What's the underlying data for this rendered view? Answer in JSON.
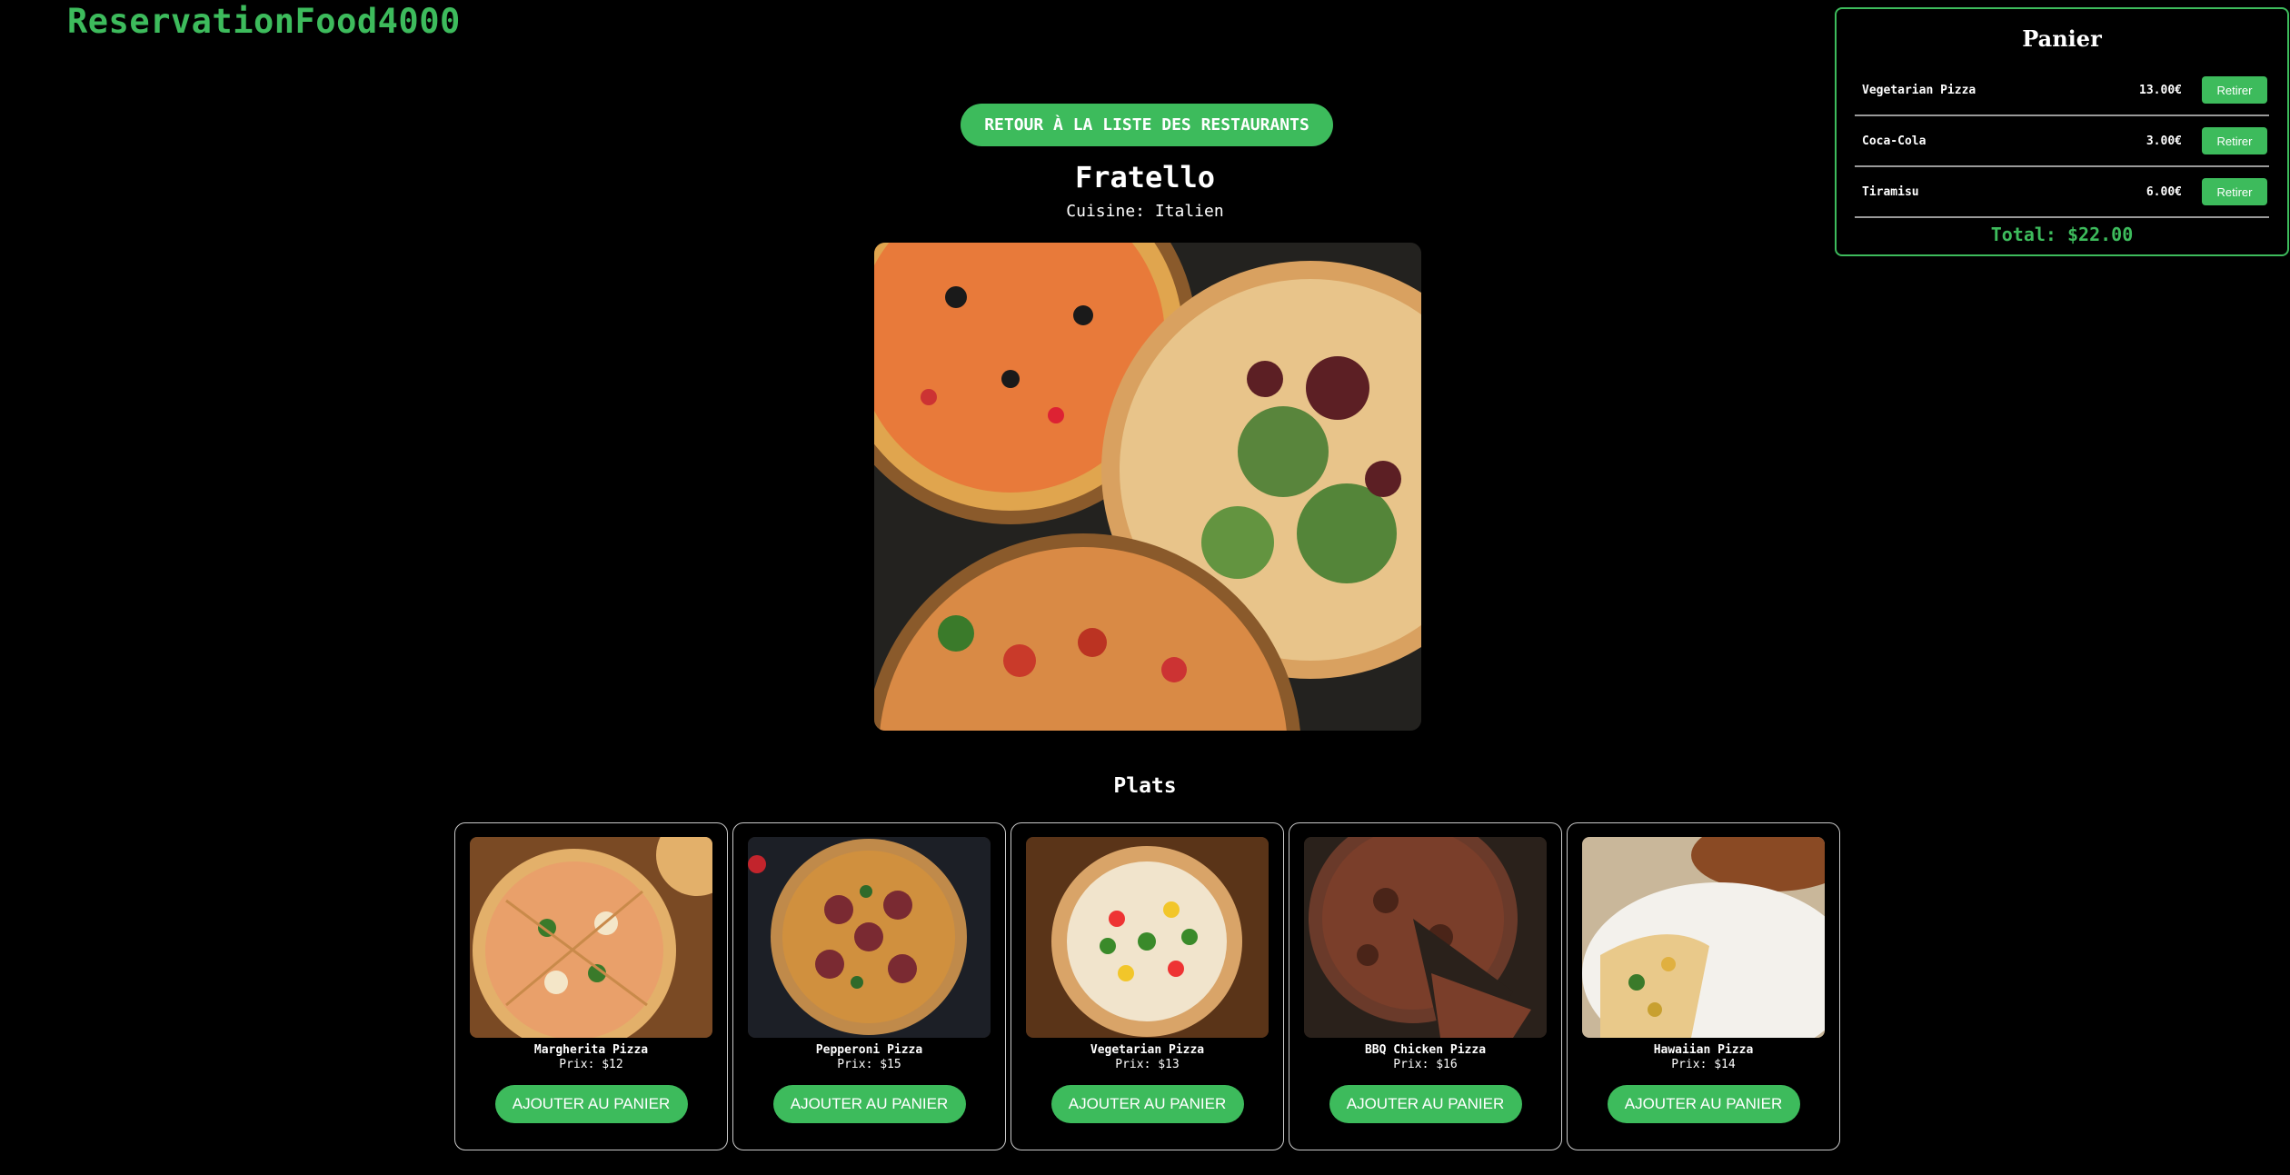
{
  "app": {
    "brand": "ReservationFood4000"
  },
  "cart": {
    "title": "Panier",
    "items": [
      {
        "name": "Vegetarian Pizza",
        "price": "13.00€",
        "remove_label": "Retirer"
      },
      {
        "name": "Coca-Cola",
        "price": "3.00€",
        "remove_label": "Retirer"
      },
      {
        "name": "Tiramisu",
        "price": "6.00€",
        "remove_label": "Retirer"
      }
    ],
    "total": "Total: $22.00"
  },
  "restaurant": {
    "back_label": "Retour à la liste des restaurants",
    "name": "Fratello",
    "cuisine": "Cuisine: Italien"
  },
  "menu": {
    "title": "Plats",
    "add_label": "AJOUTER AU PANIER",
    "dishes": [
      {
        "name": "Margherita Pizza",
        "price": "Prix: $12"
      },
      {
        "name": "Pepperoni Pizza",
        "price": "Prix: $15"
      },
      {
        "name": "Vegetarian Pizza",
        "price": "Prix: $13"
      },
      {
        "name": "BBQ Chicken Pizza",
        "price": "Prix: $16"
      },
      {
        "name": "Hawaiian Pizza",
        "price": "Prix: $14"
      }
    ]
  },
  "colors": {
    "accent": "#3dbb5c",
    "background": "#000000",
    "card_border": "#c9c9c9"
  }
}
